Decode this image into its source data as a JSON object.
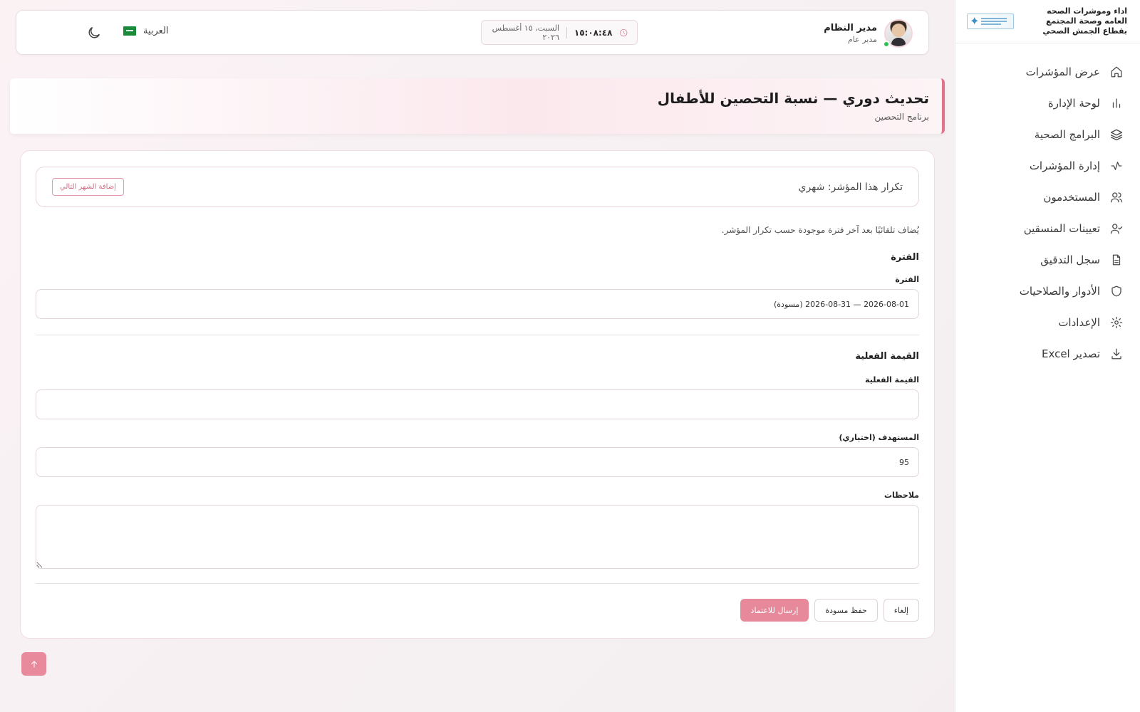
{
  "brand": {
    "title": "اداء وموشرات الصحه العامه وصحة المجتمع بقطاع الجمش الصحي",
    "logo_icon": "star-logo-icon"
  },
  "sidebar": {
    "items": [
      {
        "label": "عرض المؤشرات",
        "icon": "home-icon"
      },
      {
        "label": "لوحة الإدارة",
        "icon": "bar-chart-icon"
      },
      {
        "label": "البرامج الصحية",
        "icon": "layers-icon"
      },
      {
        "label": "إدارة المؤشرات",
        "icon": "activity-icon"
      },
      {
        "label": "المستخدمون",
        "icon": "users-icon"
      },
      {
        "label": "تعيينات المنسقين",
        "icon": "user-check-icon"
      },
      {
        "label": "سجل التدقيق",
        "icon": "file-text-icon"
      },
      {
        "label": "الأدوار والصلاحيات",
        "icon": "shield-icon"
      },
      {
        "label": "الإعدادات",
        "icon": "gear-icon"
      },
      {
        "label": "تصدير Excel",
        "icon": "download-icon"
      }
    ]
  },
  "topbar": {
    "user_name": "مدير النظام",
    "user_role": "مدير عام",
    "language": "العربية",
    "time": "١٥:٠٨:٤٨",
    "date": "السبت، ١٥ أغسطس ٢٠٢٦"
  },
  "page": {
    "title": "تحديث دوري — نسبة التحصين للأطفال",
    "subtitle": "برنامج التحصين"
  },
  "form": {
    "frequency_text": "تكرار هذا المؤشر: شهري",
    "add_next_month_label": "إضافة الشهر التالي",
    "hint": "يُضاف تلقائيًا بعد آخر فترة موجودة حسب تكرار المؤشر.",
    "period_section_title": "الفترة",
    "period_label": "الفترة",
    "period_value": "2026-08-01 — 2026-08-31 (مسودة)",
    "actual_section_title": "القيمة الفعلية",
    "actual_label": "القيمة الفعلية",
    "actual_value": "",
    "target_label": "المستهدف (اختياري)",
    "target_value": "95",
    "notes_label": "ملاحظات",
    "notes_value": ""
  },
  "actions": {
    "submit_label": "إرسال للاعتماد",
    "save_draft_label": "حفظ مسودة",
    "cancel_label": "إلغاء"
  },
  "colors": {
    "accent": "#e7899a",
    "accent_border": "#e1738b",
    "online": "#2fbf55"
  }
}
